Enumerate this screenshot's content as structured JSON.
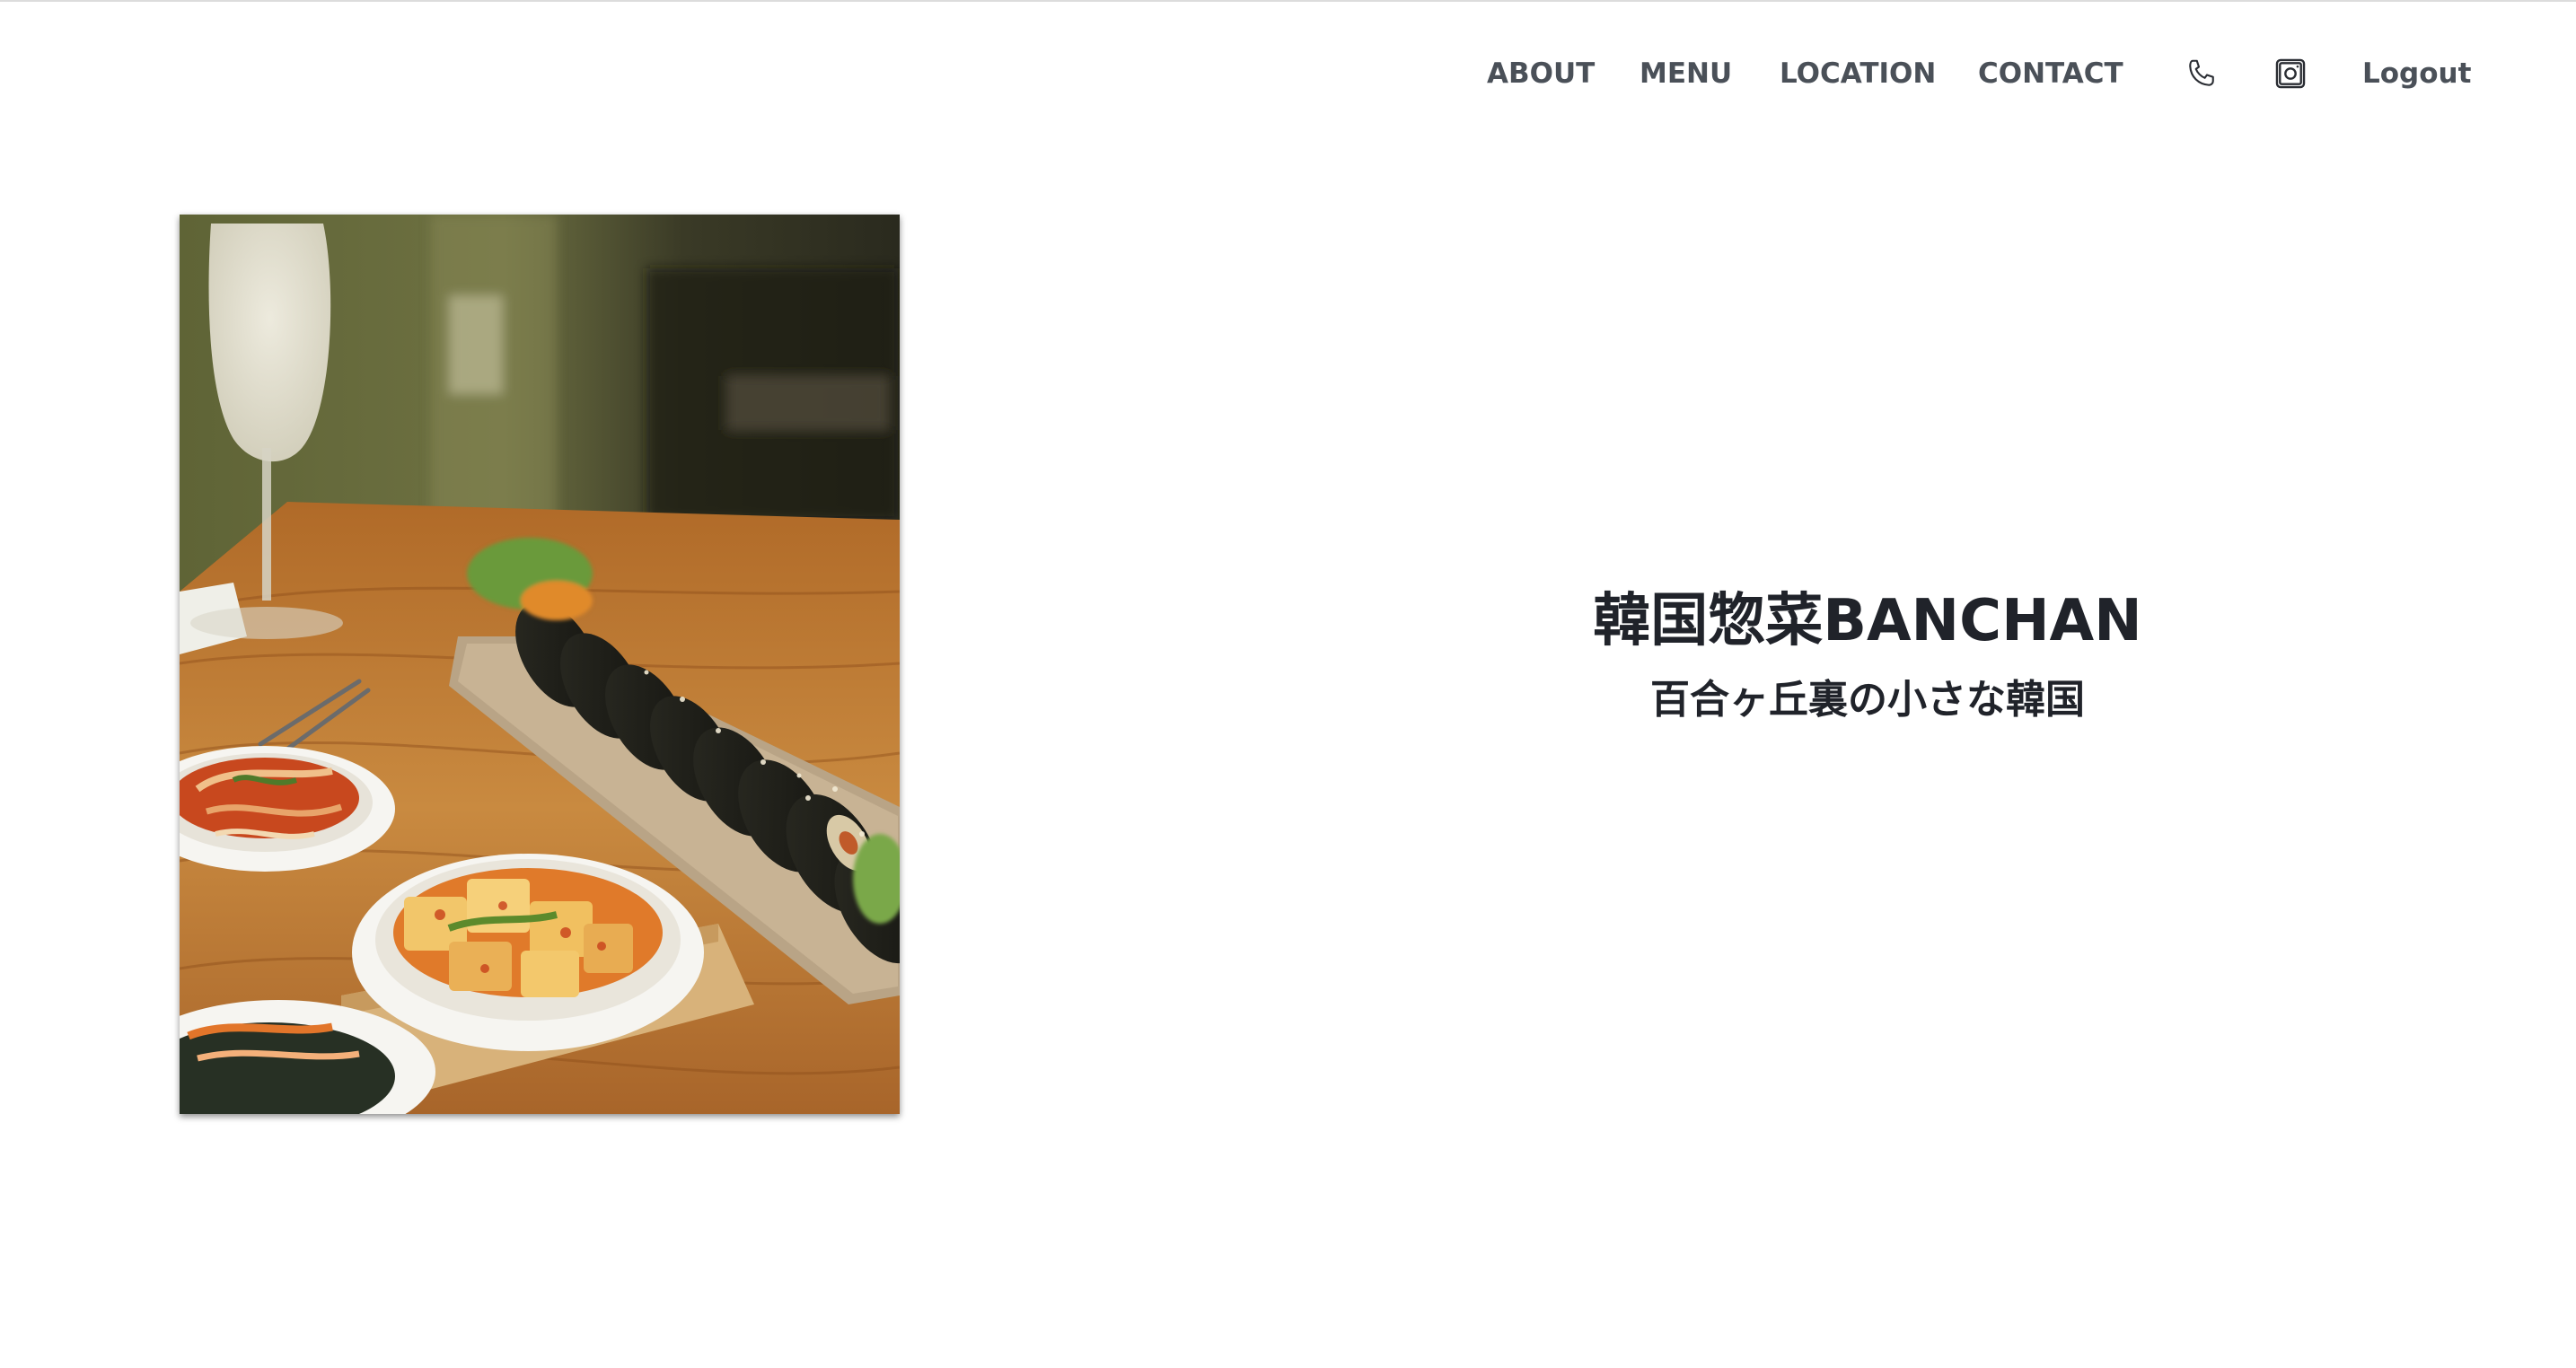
{
  "nav": {
    "about": "ABOUT",
    "menu": "MENU",
    "location": "LOCATION",
    "contact": "CONTACT",
    "phone_icon": "phone-icon",
    "instagram_icon": "instagram-icon",
    "logout": "Logout"
  },
  "hero": {
    "title": "韓国惣菜BANCHAN",
    "subtitle": "百合ヶ丘裏の小さな韓国"
  },
  "colors": {
    "nav_text": "#4a5058",
    "heading": "#20232a",
    "background": "#ffffff"
  }
}
